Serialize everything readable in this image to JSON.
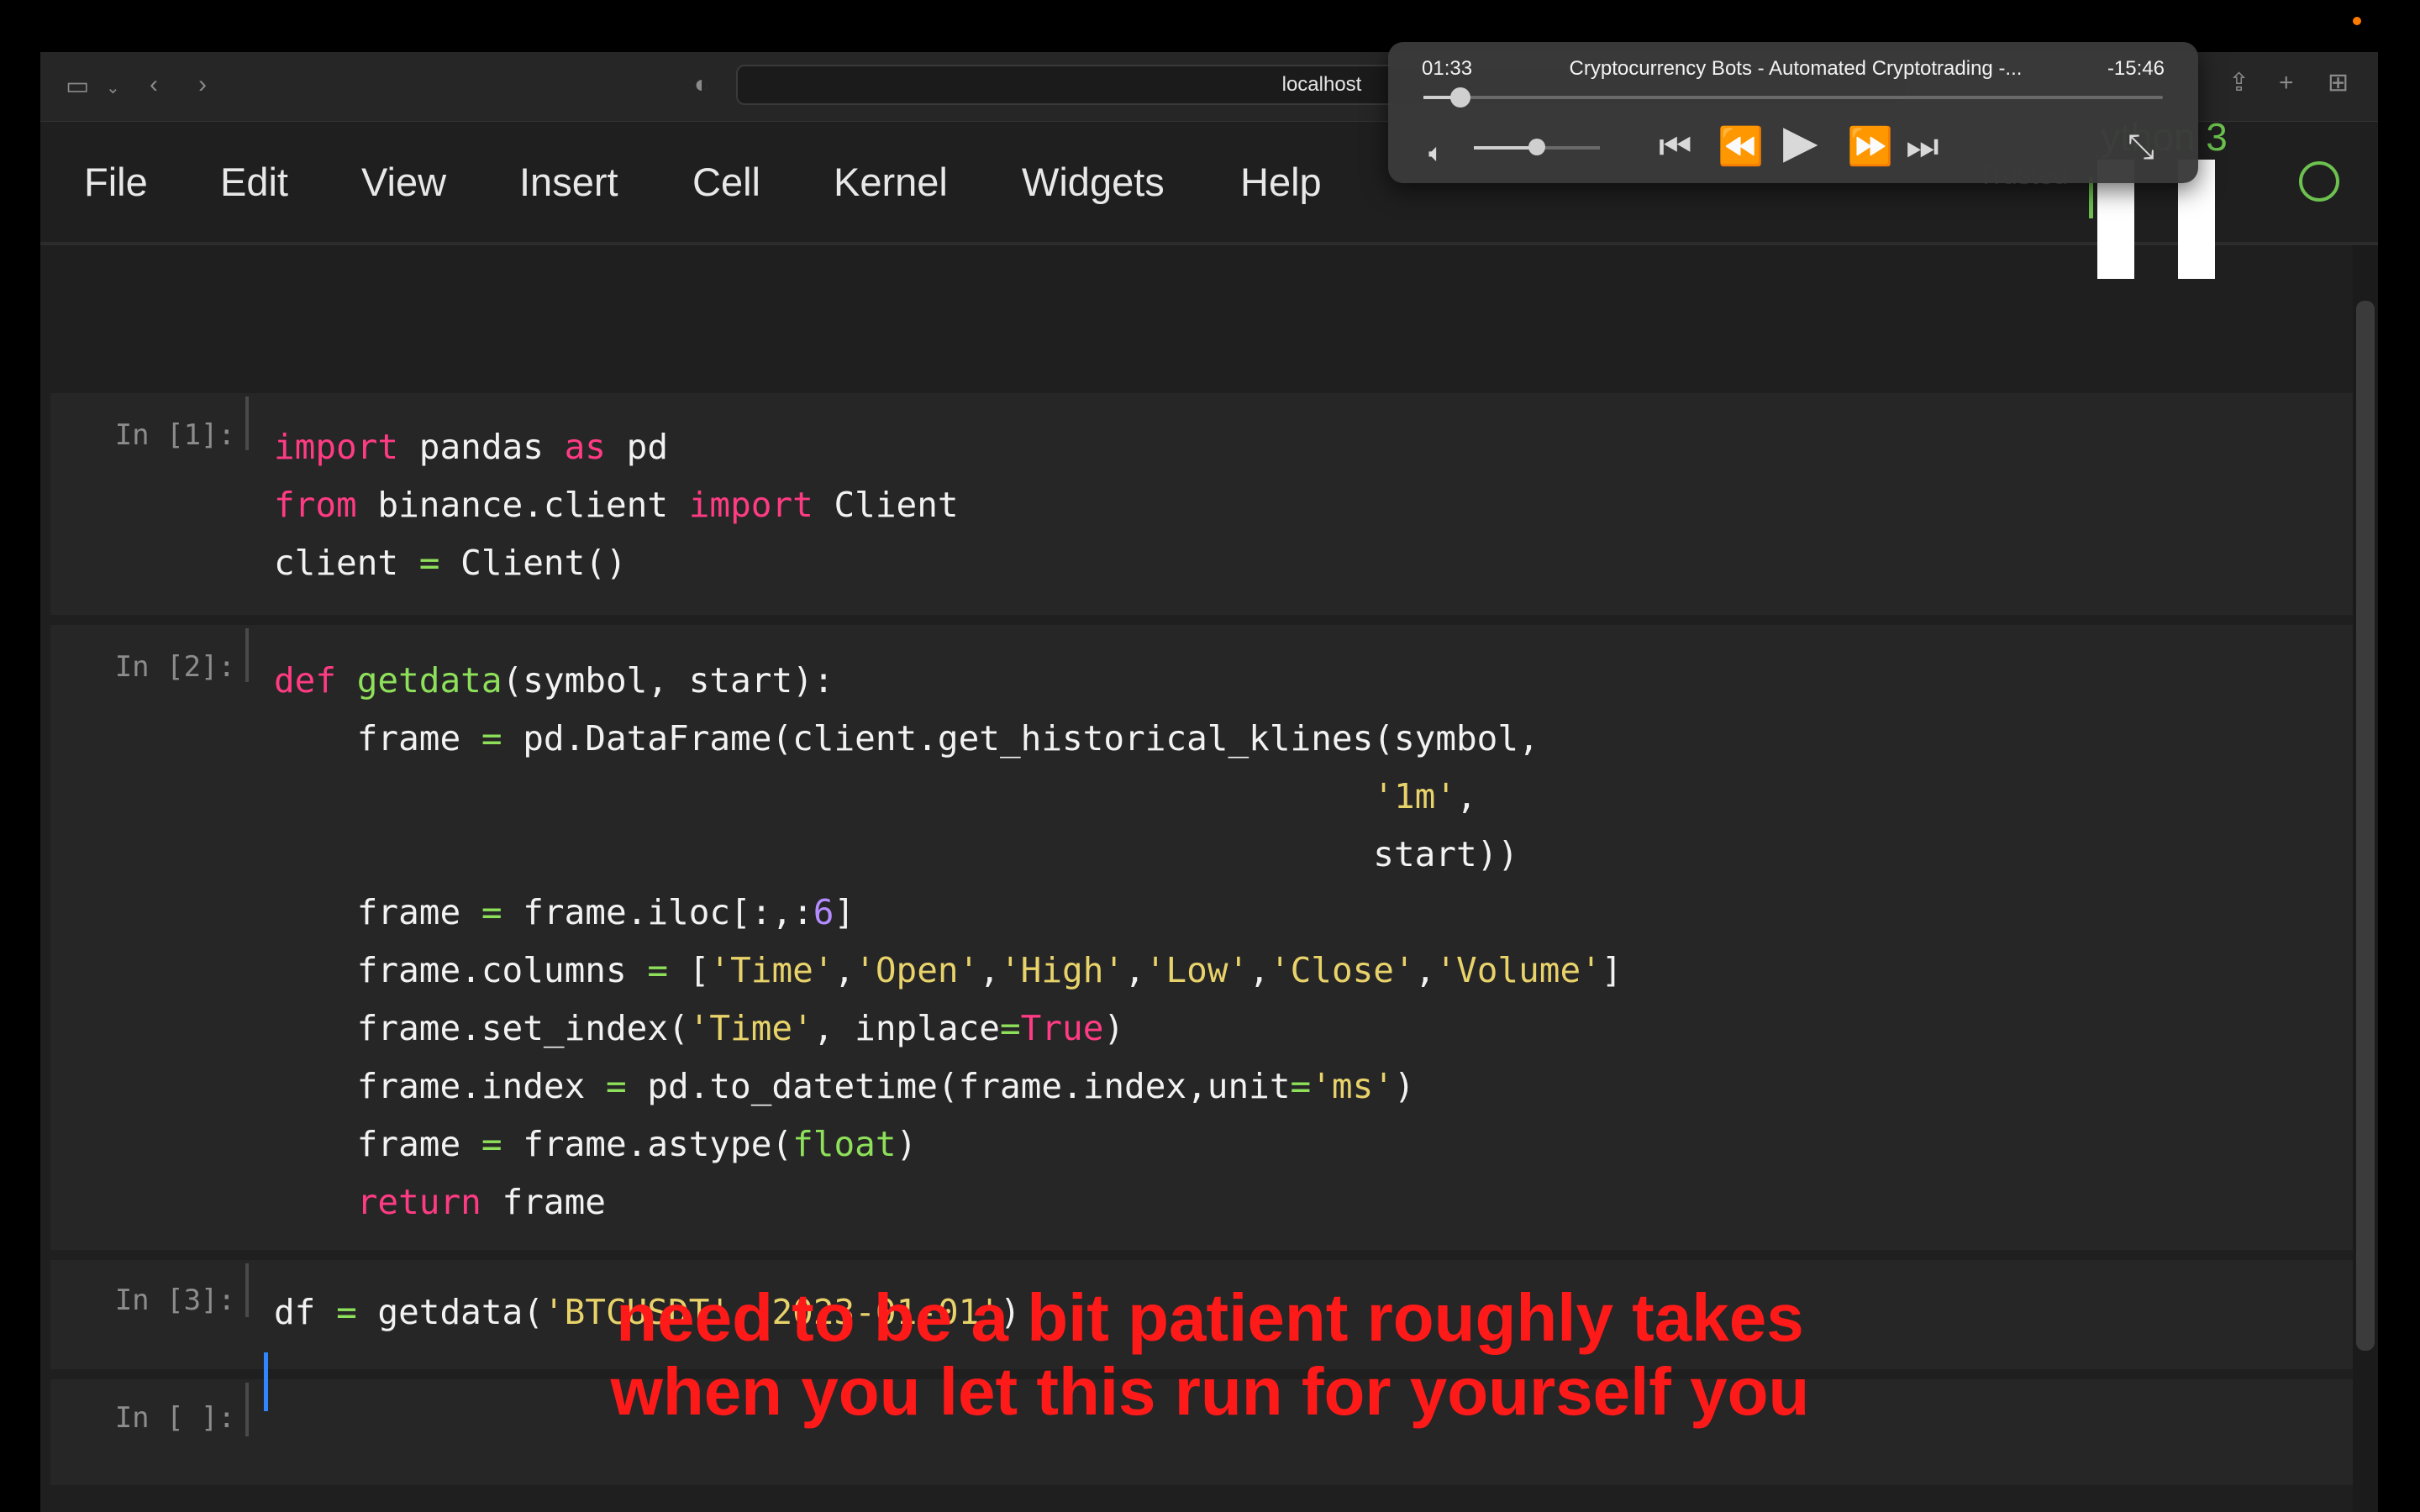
{
  "browser": {
    "address": "localhost"
  },
  "menu": {
    "items": [
      "File",
      "Edit",
      "View",
      "Insert",
      "Cell",
      "Kernel",
      "Widgets",
      "Help"
    ],
    "trusted": "Trusted",
    "kernel_name": "ython 3"
  },
  "cells": [
    {
      "prompt": "In [1]:"
    },
    {
      "prompt": "In [2]:"
    },
    {
      "prompt": "In [3]:"
    },
    {
      "prompt": "In [ ]:"
    }
  ],
  "caption": {
    "line1": "need to be a bit patient roughly takes",
    "line2": "when you let this run for yourself you"
  },
  "player": {
    "elapsed": "01:33",
    "title": "Cryptocurrency Bots - Automated Cryptotrading -...",
    "remaining": "-15:46",
    "progress": 0.05,
    "volume": 0.5
  },
  "icons": [
    "sidebar-icon",
    "chevron-down-icon",
    "back-icon",
    "forward-icon",
    "shield-icon",
    "share-icon",
    "plus-icon",
    "tabs-icon",
    "volume-icon",
    "skip-back-icon",
    "rewind-icon",
    "play-icon",
    "fast-forward-icon",
    "skip-forward-icon",
    "collapse-icon"
  ]
}
